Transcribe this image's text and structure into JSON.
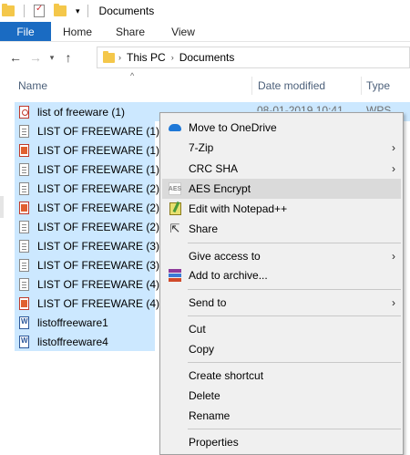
{
  "window": {
    "title": "Documents"
  },
  "ribbon": {
    "tabs": [
      "File",
      "Home",
      "Share",
      "View"
    ]
  },
  "address": {
    "crumbs": [
      "This PC",
      "Documents"
    ]
  },
  "columns": {
    "name": "Name",
    "date": "Date modified",
    "type": "Type"
  },
  "files": [
    {
      "name": "list of freeware (1)",
      "icon": "pdf-file-icon",
      "date": "08-01-2019 10:41",
      "type": "WPS PDF"
    },
    {
      "name": "LIST OF FREEWARE (1)",
      "icon": "text-file-icon"
    },
    {
      "name": "LIST OF FREEWARE (1)",
      "icon": "wps-file-icon"
    },
    {
      "name": "LIST OF FREEWARE (1)",
      "icon": "text-file-icon"
    },
    {
      "name": "LIST OF FREEWARE (2)",
      "icon": "text-file-icon"
    },
    {
      "name": "LIST OF FREEWARE (2)",
      "icon": "wps-file-icon"
    },
    {
      "name": "LIST OF FREEWARE (2)",
      "icon": "text-file-icon"
    },
    {
      "name": "LIST OF FREEWARE (3)",
      "icon": "text-file-icon"
    },
    {
      "name": "LIST OF FREEWARE (3)",
      "icon": "text-file-icon"
    },
    {
      "name": "LIST OF FREEWARE (4)",
      "icon": "text-file-icon"
    },
    {
      "name": "LIST OF FREEWARE (4)",
      "icon": "wps-file-icon"
    },
    {
      "name": "listoffreeware1",
      "icon": "word-file-icon"
    },
    {
      "name": "listoffreeware4",
      "icon": "word-file-icon"
    }
  ],
  "context_menu": {
    "items": [
      {
        "label": "Move to OneDrive",
        "icon": "onedrive-icon"
      },
      {
        "label": "7-Zip",
        "submenu": true
      },
      {
        "label": "CRC SHA",
        "submenu": true
      },
      {
        "label": "AES Encrypt",
        "icon": "aes-icon",
        "icon_text": "AES",
        "highlighted": true
      },
      {
        "label": "Edit with Notepad++",
        "icon": "notepad-plus-plus-icon"
      },
      {
        "label": "Share",
        "icon": "share-icon"
      },
      {
        "label": "Give access to",
        "submenu": true
      },
      {
        "label": "Add to archive...",
        "icon": "winrar-icon"
      },
      {
        "label": "Send to",
        "submenu": true
      },
      {
        "label": "Cut"
      },
      {
        "label": "Copy"
      },
      {
        "label": "Create shortcut"
      },
      {
        "label": "Delete"
      },
      {
        "label": "Rename"
      },
      {
        "label": "Properties"
      }
    ]
  },
  "colors": {
    "selection": "#cce8ff",
    "file_tab": "#1a6bc2",
    "menu_bg": "#f0f0f0",
    "menu_hover": "#dadada"
  }
}
